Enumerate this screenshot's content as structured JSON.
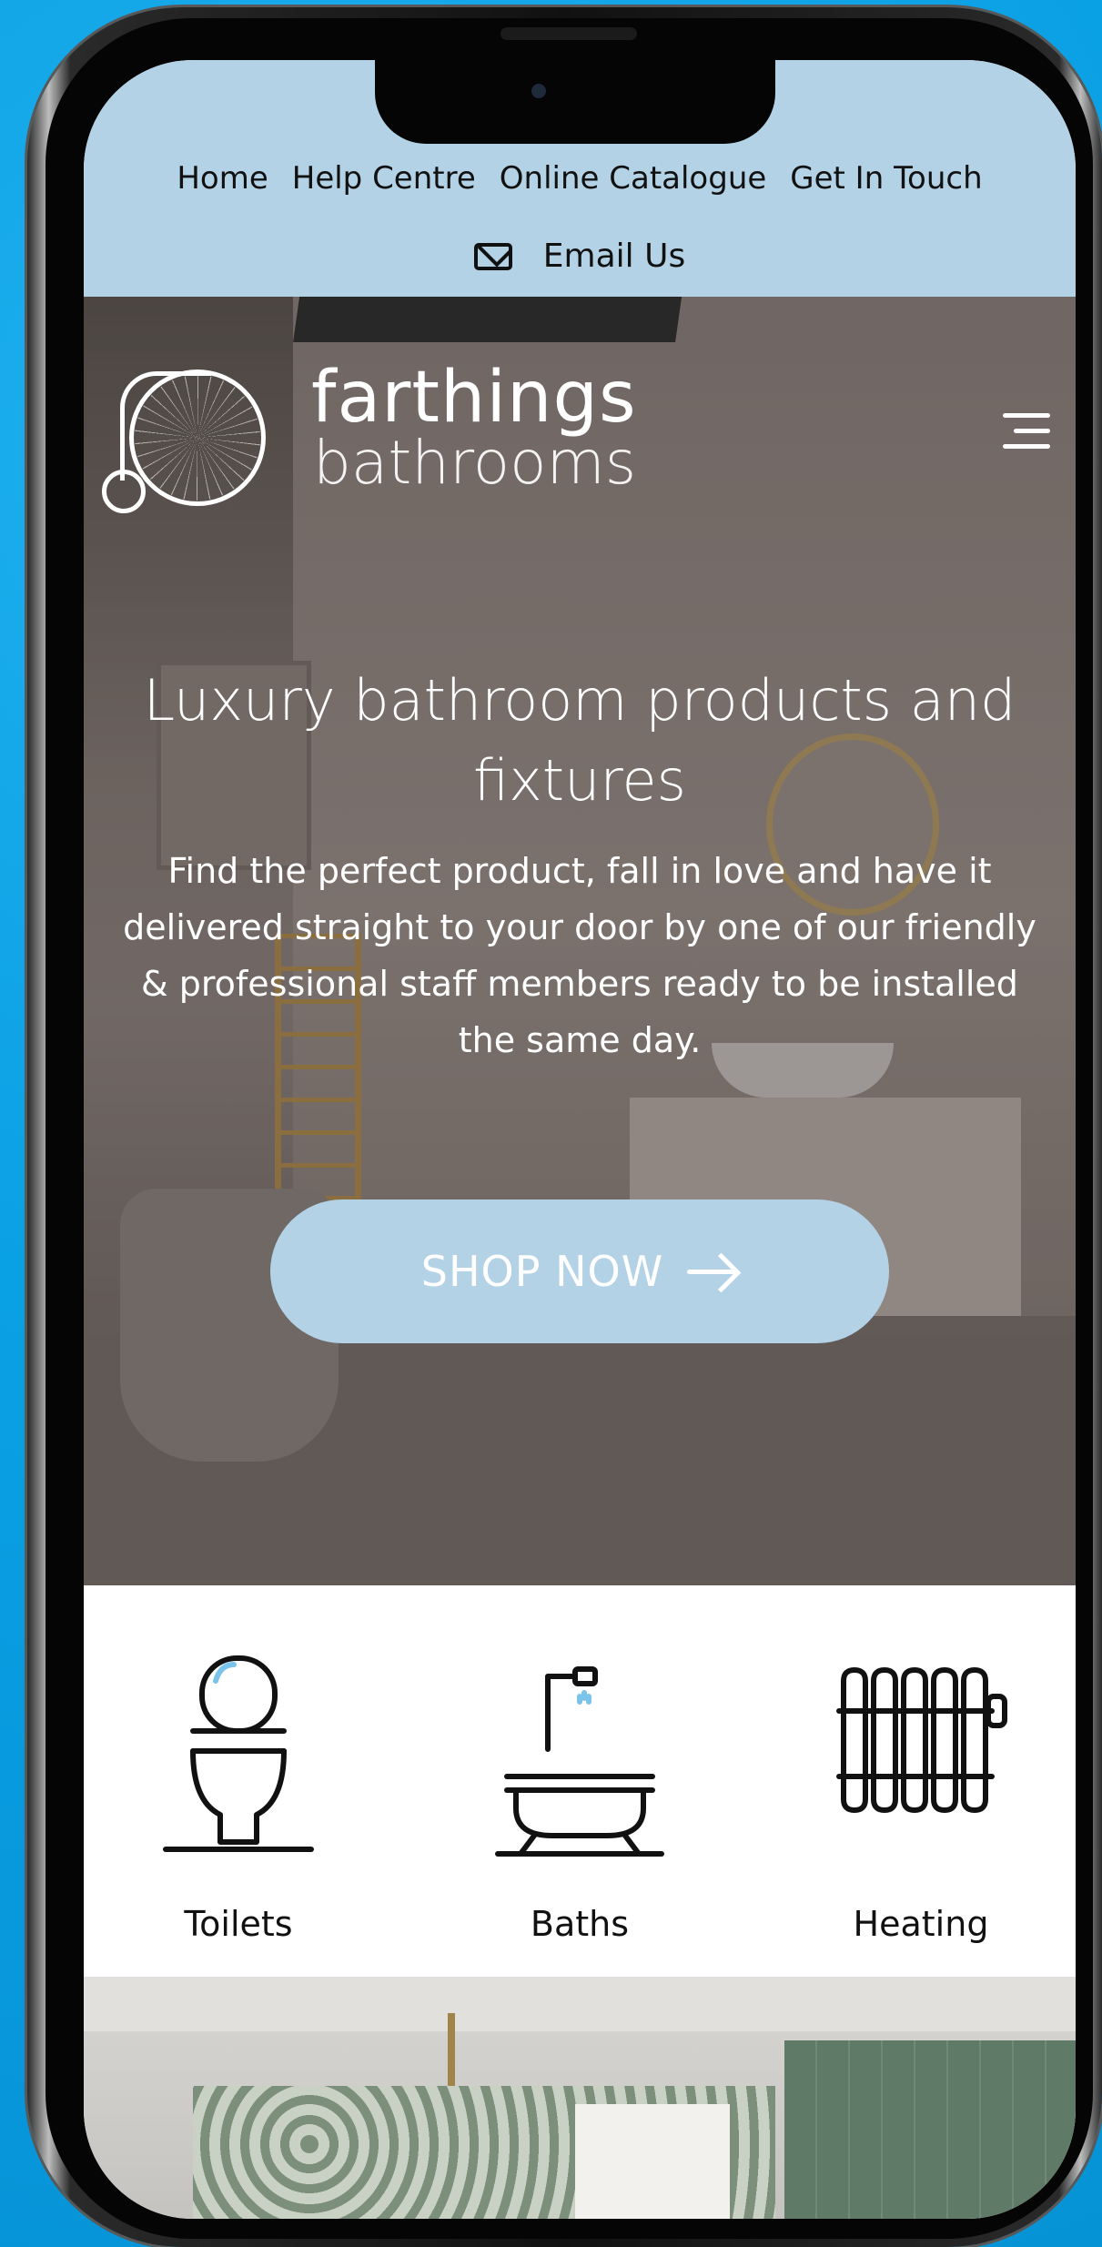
{
  "nav": {
    "links": [
      "Home",
      "Help Centre",
      "Online Catalogue",
      "Get In Touch"
    ],
    "email_label": "Email Us"
  },
  "logo": {
    "line1": "farthings",
    "line2": "bathrooms"
  },
  "hero": {
    "heading": "Luxury bathroom products and fixtures",
    "description": "Find the perfect product, fall in love and have it delivered straight to your door by one of our friendly & professional staff members ready to be installed the same day.",
    "cta_label": "SHOP NOW"
  },
  "categories": [
    {
      "label": "Toilets",
      "icon": "toilet-icon"
    },
    {
      "label": "Baths",
      "icon": "bath-icon"
    },
    {
      "label": "Heating",
      "icon": "radiator-icon"
    }
  ],
  "colors": {
    "background": "#0aa0e4",
    "nav_bg": "#b4d2e6",
    "cta_bg": "#b4d2e6",
    "text": "#111111"
  }
}
